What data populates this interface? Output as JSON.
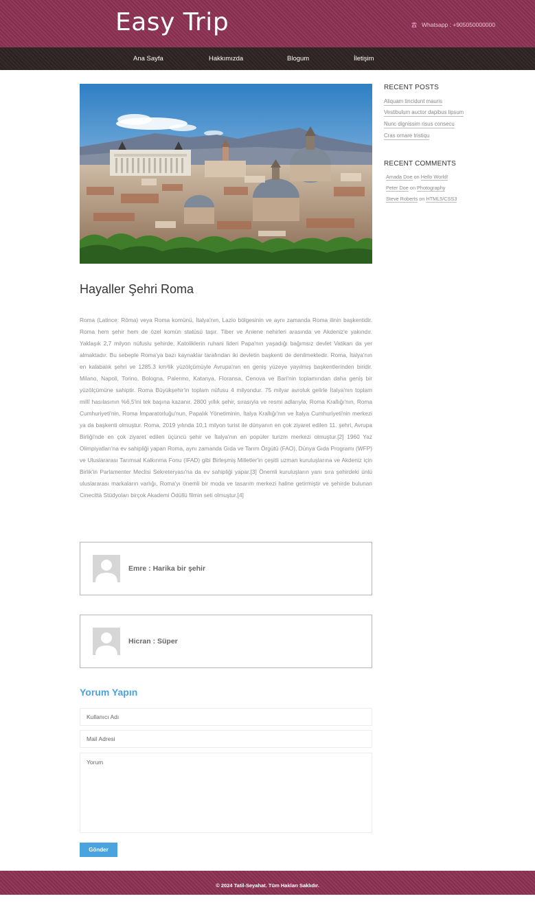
{
  "header": {
    "logo": "Easy Trip",
    "phone_icon": "phone-icon",
    "phone": "Whatsapp : +905050000000",
    "nav": [
      "Ana Sayfa",
      "Hakkımızda",
      "Blogum",
      "İletişim"
    ]
  },
  "post": {
    "image": "rome-cityscape",
    "title": "Hayaller Şehri Roma",
    "body": "Roma (Latince: Rōma) veya Roma komünü, İtalya'nın, Lazio bölgesinin ve aynı zamanda Roma ilinin başkentidir. Roma hem şehir hem de özel komün statüsü taşır. Tiber ve Aniene nehirleri arasında ve Akdeniz'e yakındır. Yaklaşık 2,7 milyon nüfuslu şehirde, Katoliklerin ruhani lideri Papa'nın yaşadığı bağımsız devlet Vatikan da yer almaktadır. Bu sebeple Roma'ya bazı kaynaklar tarafından iki devletin başkenti de denilmektedir. Roma, İtalya'nın en kalabalık şehri ve 1285.3 km²lik yüzölçümüyle Avrupa'nın en geniş yüzeye yayılmış başkentlerinden biridir. Milano, Napoli, Torino, Bologna, Palermo, Katanya, Floransa, Cenova ve Bari'nin toplamından daha geniş bir yüzölçümüne sahiptir. Roma Büyükşehir'in toplam nüfusu 4 milyondur. 75 milyar avroluk gelirle İtalya'nın toplam millî hasılasının %6,5'ini tek başına kazanır. 2800 yıllık şehir, sırasıyla ve resmi adlarıyla; Roma Krallığı'nın, Roma Cumhuriyeti'nin, Roma İmparatorluğu'nun, Papalık Yönetiminin, İtalya Krallığı'nın ve İtalya Cumhuriyeti'nin merkezi ya da başkenti olmuştur. Roma, 2019 yılında 10,1 milyon turist ile dünyanın en çok ziyaret edilen 11. şehri, Avrupa Birliği'nde en çok ziyaret edilen üçüncü şehir ve İtalya'nın en popüler turizm merkezi olmuştur.[2] 1960 Yaz Olimpiyatları'na ev sahipliği yapan Roma, aynı zamanda Gıda ve Tarım Örgütü (FAO), Dünya Gıda Programı (WFP) ve Uluslararası Tarımsal Kalkınma Fonu (IFAD) gibi Birleşmiş Milletler'in çeşitli uzman kuruluşlarına ve Akdeniz için Birlik'in Parlamenter Meclisi Sekreteryası'na da ev sahipliği yapar.[3] Önemli kuruluşların yanı sıra şehirdeki ünlü uluslararası markaların varlığı, Roma'yı önemli bir moda ve tasarım merkezi haline getirmiştir ve şehirde bulunan Cinecittà Stüdyoları birçok Akademi Ödüllü filmin seti olmuştur.[4]"
  },
  "comments": [
    {
      "avatar": "user-avatar-icon",
      "text": "Emre : Harika bir şehir"
    },
    {
      "avatar": "user-avatar-icon",
      "text": "Hicran : Süper"
    }
  ],
  "form": {
    "title": "Yorum Yapın",
    "username_placeholder": "Kullanıcı Adı",
    "email_placeholder": "Mail Adresi",
    "comment_placeholder": "Yorum",
    "submit": "Gönder"
  },
  "sidebar": {
    "recent_posts_title": "RECENT POSTS",
    "recent_posts": [
      "Aliquam tincidunt mauris",
      "Vestibulum auctor dapibus lipsum",
      "Nunc dignissim risus consecu",
      "Cras ornare tristiqu"
    ],
    "recent_comments_title": "RECENT COMMENTS",
    "recent_comments": [
      {
        "author": "Amada Doe",
        "on": "on",
        "post": "Hello World!"
      },
      {
        "author": "Peter Doe",
        "on": "on",
        "post": "Photography"
      },
      {
        "author": "Steve Roberts",
        "on": "on",
        "post": "HTML5/CSS3"
      }
    ]
  },
  "footer": {
    "text": "© 2024 Tatil-Seyahat. Tüm Hakları Saklıdır."
  },
  "colors": {
    "header_bg": "#8b3050",
    "nav_bg": "#2e2424",
    "accent": "#4aa3df"
  }
}
